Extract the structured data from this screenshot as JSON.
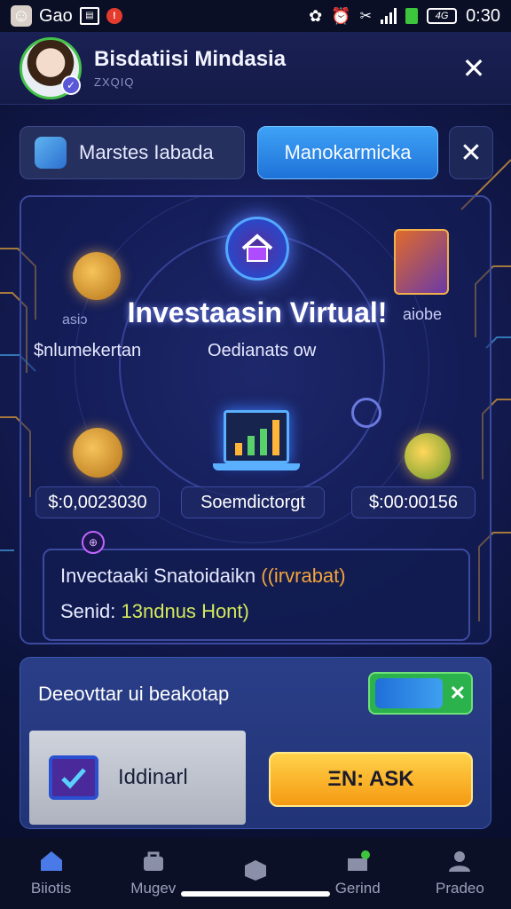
{
  "status_bar": {
    "app_label": "Gao",
    "badge": "!",
    "time": "0:30",
    "battery": "4G"
  },
  "header": {
    "title": "Bisdatiisi Mindasia",
    "subtitle": "ZXQIQ",
    "close_label": "✕"
  },
  "tabs": [
    {
      "label": "Marstes Iabada"
    },
    {
      "label": "Manokarmicka"
    },
    {
      "label": "✕"
    }
  ],
  "panel": {
    "title": "Investaasin Virtual!",
    "side_left_small": "asiɔ",
    "side_left": "$nlumekertan",
    "side_center": "Oedianats ow",
    "side_right": "aiobe",
    "stats": [
      {
        "value": "$:0,0023030"
      },
      {
        "value": "Soemdictorgt"
      },
      {
        "value": "$:00:00156"
      }
    ],
    "info": {
      "line1_main": "Invectaaki Snatoidaikn",
      "line1_highlight": "((irvrabat)",
      "line2_main": "Senid:",
      "line2_green": "13ndnus",
      "line2_tail": "Hont)"
    }
  },
  "bottom_panel": {
    "title": "Deeovttar ui beakotap",
    "toggle_close": "✕",
    "card_label": "Iddinarl",
    "action_label": "ΞN: ASK"
  },
  "nav": [
    {
      "label": "Biiotis",
      "icon": "home-icon"
    },
    {
      "label": "Mugev",
      "icon": "bag-icon"
    },
    {
      "label": "",
      "icon": "box-icon"
    },
    {
      "label": "Gerind",
      "icon": "gift-icon"
    },
    {
      "label": "Pradeo",
      "icon": "profile-icon"
    }
  ],
  "colors": {
    "accent_blue": "#3ea2f6",
    "accent_orange": "#f59a12",
    "toggle_green": "#2bb24c",
    "highlight_orange": "#f3a43a",
    "highlight_green": "#d4e95a"
  }
}
